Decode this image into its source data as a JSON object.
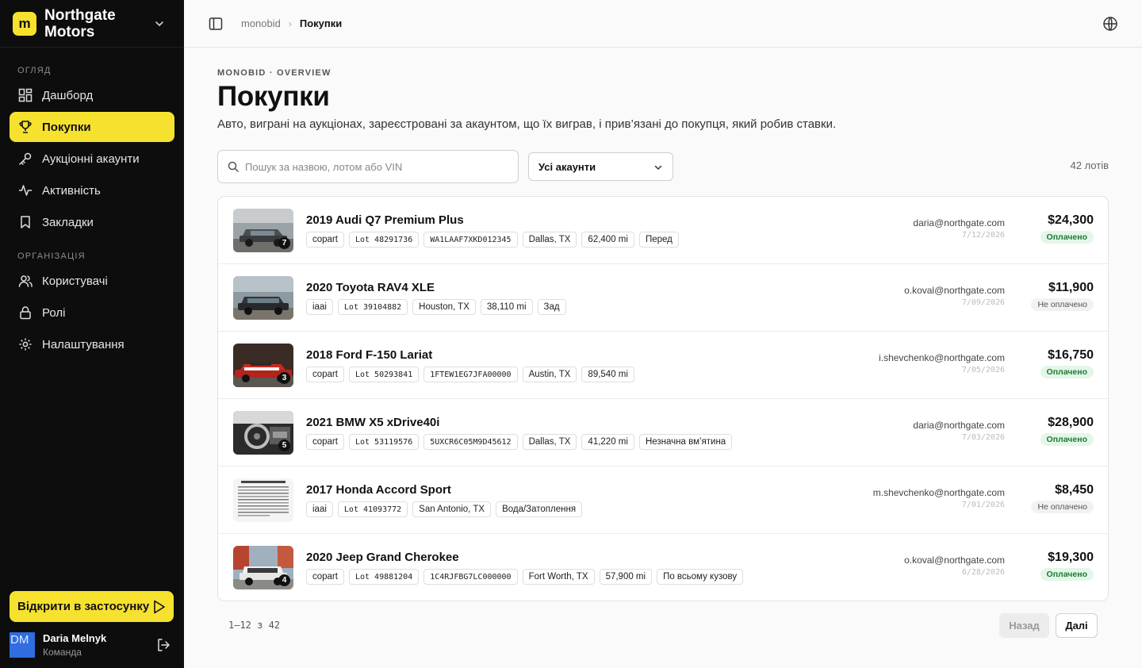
{
  "brand": {
    "logo_letter": "m",
    "name": "Northgate Motors"
  },
  "sidebar": {
    "section_overview": "ОГЛЯД",
    "section_org": "ОРГАНІЗАЦІЯ",
    "items": [
      {
        "label": "Дашборд",
        "icon": "dashboard-icon"
      },
      {
        "label": "Покупки",
        "icon": "trophy-icon"
      },
      {
        "label": "Аукціонні акаунти",
        "icon": "key-icon"
      },
      {
        "label": "Активність",
        "icon": "activity-icon"
      },
      {
        "label": "Закладки",
        "icon": "bookmark-icon"
      },
      {
        "label": "Користувачі",
        "icon": "users-icon"
      },
      {
        "label": "Ролі",
        "icon": "lock-icon"
      },
      {
        "label": "Налаштування",
        "icon": "gear-icon"
      }
    ],
    "open_app_label": "Відкрити в застосунку",
    "user": {
      "initials": "DM",
      "name": "Daria Melnyk",
      "role": "Команда"
    }
  },
  "topbar": {
    "crumb_root": "monobid",
    "crumb_sep": "›",
    "crumb_current": "Покупки"
  },
  "page": {
    "overline": "MONOBID · OVERVIEW",
    "title": "Покупки",
    "subtitle": "Авто, виграні на аукціонах, зареєстровані за акаунтом, що їх виграв, і прив’язані до покупця, який робив ставки."
  },
  "filters": {
    "search_placeholder": "Пошук за назвою, лотом або VIN",
    "account_select": "Усі акаунти",
    "count": "42 лотів"
  },
  "rows": [
    {
      "name": "2019 Audi Q7 Premium Plus",
      "photos": "7",
      "tags": [
        "copart",
        "Lot 48291736",
        "WA1LAAF7XKD012345",
        "Dallas, TX",
        "62,400 mi",
        "Перед"
      ],
      "email": "daria@northgate.com",
      "date": "7/12/2026",
      "price": "$24,300",
      "status": "Оплачено",
      "paid": true
    },
    {
      "name": "2020 Toyota RAV4 XLE",
      "photos": "",
      "tags": [
        "iaai",
        "Lot 39104882",
        "Houston, TX",
        "38,110 mi",
        "Зад"
      ],
      "email": "o.koval@northgate.com",
      "date": "7/09/2026",
      "price": "$11,900",
      "status": "Не оплачено",
      "paid": false
    },
    {
      "name": "2018 Ford F-150 Lariat",
      "photos": "3",
      "tags": [
        "copart",
        "Lot 50293841",
        "1FTEW1EG7JFA00000",
        "Austin, TX",
        "89,540 mi"
      ],
      "email": "i.shevchenko@northgate.com",
      "date": "7/05/2026",
      "price": "$16,750",
      "status": "Оплачено",
      "paid": true
    },
    {
      "name": "2021 BMW X5 xDrive40i",
      "photos": "5",
      "tags": [
        "copart",
        "Lot 53119576",
        "5UXCR6C05M9D45612",
        "Dallas, TX",
        "41,220 mi",
        "Незначна вм’ятина"
      ],
      "email": "daria@northgate.com",
      "date": "7/03/2026",
      "price": "$28,900",
      "status": "Оплачено",
      "paid": true
    },
    {
      "name": "2017 Honda Accord Sport",
      "photos": "",
      "tags": [
        "iaai",
        "Lot 41093772",
        "San Antonio, TX",
        "Вода/Затоплення"
      ],
      "email": "m.shevchenko@northgate.com",
      "date": "7/01/2026",
      "price": "$8,450",
      "status": "Не оплачено",
      "paid": false
    },
    {
      "name": "2020 Jeep Grand Cherokee",
      "photos": "4",
      "tags": [
        "copart",
        "Lot 49881204",
        "1C4RJFBG7LC000000",
        "Fort Worth, TX",
        "57,900 mi",
        "По всьому кузову"
      ],
      "email": "o.koval@northgate.com",
      "date": "6/28/2026",
      "price": "$19,300",
      "status": "Оплачено",
      "paid": true
    }
  ],
  "pager": {
    "info": "1–12 з 42",
    "prev": "Назад",
    "next": "Далі"
  },
  "colors": {
    "accent": "#f6e12f",
    "sidebar_bg": "#0d0d0d",
    "paid_bg": "#e4f6e8",
    "paid_text": "#1e7a36"
  }
}
